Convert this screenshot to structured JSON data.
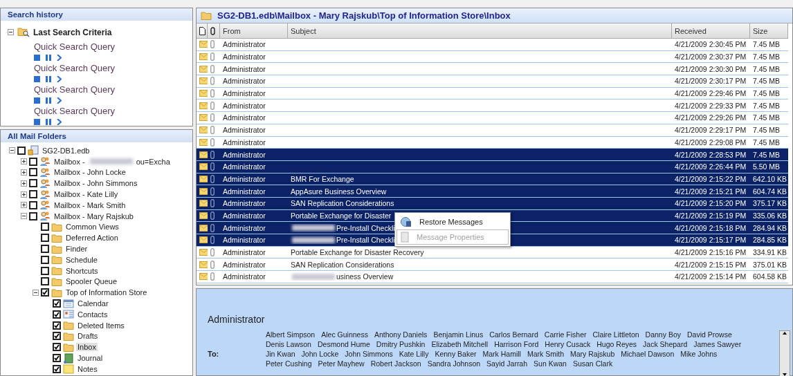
{
  "search_history": {
    "title": "Search history",
    "root": {
      "label": "Last Search Criteria",
      "expanded": true
    },
    "queries": [
      {
        "label": "Quick Search Query"
      },
      {
        "label": "Quick Search Query"
      },
      {
        "label": "Quick Search Query"
      },
      {
        "label": "Quick Search Query"
      }
    ]
  },
  "folders": {
    "title": "All Mail Folders",
    "tree": [
      {
        "label": "SG2-DB1.edb",
        "kind": "database",
        "checked": false,
        "expanded": true,
        "children": [
          {
            "label": "Mailbox -",
            "redacted": true,
            "label_end": "ou=Excha",
            "kind": "mailbox",
            "checked": false,
            "expanded": false
          },
          {
            "label": "Mailbox - John Locke",
            "kind": "mailbox",
            "checked": false,
            "expanded": false
          },
          {
            "label": "Mailbox - John Simmons",
            "kind": "mailbox",
            "checked": false,
            "expanded": false
          },
          {
            "label": "Mailbox - Kate Lilly",
            "kind": "mailbox",
            "checked": false,
            "expanded": false
          },
          {
            "label": "Mailbox - Mark Smith",
            "kind": "mailbox",
            "checked": false,
            "expanded": false
          },
          {
            "label": "Mailbox - Mary Rajskub",
            "kind": "mailbox",
            "checked": false,
            "expanded": true,
            "children": [
              {
                "label": "Common Views",
                "kind": "folder",
                "checked": false
              },
              {
                "label": "Deferred Action",
                "kind": "folder",
                "checked": false
              },
              {
                "label": "Finder",
                "kind": "folder",
                "checked": false
              },
              {
                "label": "Schedule",
                "kind": "folder",
                "checked": false
              },
              {
                "label": "Shortcuts",
                "kind": "folder",
                "checked": false
              },
              {
                "label": "Spooler Queue",
                "kind": "folder",
                "checked": false
              },
              {
                "label": "Top of Information Store",
                "kind": "folder",
                "checked": true,
                "expanded": true,
                "children": [
                  {
                    "label": "Calendar",
                    "kind": "calendar",
                    "checked": true,
                    "selected": false
                  },
                  {
                    "label": "Contacts",
                    "kind": "contacts",
                    "checked": true,
                    "selected": false
                  },
                  {
                    "label": "Deleted Items",
                    "kind": "folder",
                    "checked": true,
                    "selected": false
                  },
                  {
                    "label": "Drafts",
                    "kind": "folder",
                    "checked": true,
                    "selected": false
                  },
                  {
                    "label": "Inbox",
                    "kind": "folder",
                    "checked": true,
                    "selected": true
                  },
                  {
                    "label": "Journal",
                    "kind": "journal",
                    "checked": true,
                    "selected": false
                  },
                  {
                    "label": "Notes",
                    "kind": "notes",
                    "checked": true,
                    "selected": false
                  }
                ]
              }
            ]
          }
        ]
      }
    ]
  },
  "messages": {
    "path": "SG2-DB1.edb\\Mailbox - Mary Rajskub\\Top of Information Store\\Inbox",
    "columns": [
      "From",
      "Subject",
      "Received",
      "Size"
    ],
    "rows": [
      {
        "from": "Administrator",
        "received": "4/21/2009 2:30:45 PM",
        "size": "7.45 MB",
        "selected": false
      },
      {
        "from": "Administrator",
        "received": "4/21/2009 2:30:37 PM",
        "size": "7.45 MB",
        "selected": false
      },
      {
        "from": "Administrator",
        "received": "4/21/2009 2:30:30 PM",
        "size": "7.45 MB",
        "selected": false
      },
      {
        "from": "Administrator",
        "received": "4/21/2009 2:30:17 PM",
        "size": "7.45 MB",
        "selected": false
      },
      {
        "from": "Administrator",
        "received": "4/21/2009 2:29:46 PM",
        "size": "7.45 MB",
        "selected": false
      },
      {
        "from": "Administrator",
        "received": "4/21/2009 2:29:33 PM",
        "size": "7.45 MB",
        "selected": false
      },
      {
        "from": "Administrator",
        "received": "4/21/2009 2:29:26 PM",
        "size": "7.45 MB",
        "selected": false
      },
      {
        "from": "Administrator",
        "received": "4/21/2009 2:29:17 PM",
        "size": "7.45 MB",
        "selected": false
      },
      {
        "from": "Administrator",
        "received": "4/21/2009 2:29:08 PM",
        "size": "7.45 MB",
        "selected": false
      },
      {
        "from": "Administrator",
        "received": "4/21/2009 2:28:53 PM",
        "size": "7.45 MB",
        "selected": true
      },
      {
        "from": "Administrator",
        "received": "4/21/2009 2:26:44 PM",
        "size": "5.50 MB",
        "selected": true
      },
      {
        "from": "Administrator",
        "subject": "BMR For Exchange",
        "received": "4/21/2009 2:15:22 PM",
        "size": "642.10 KB",
        "selected": true
      },
      {
        "from": "Administrator",
        "subject": "AppAsure Business Overview",
        "received": "4/21/2009 2:15:21 PM",
        "size": "604.74 KB",
        "selected": true
      },
      {
        "from": "Administrator",
        "subject": "SAN Replication Considerations",
        "received": "4/21/2009 2:15:20 PM",
        "size": "375.17 KB",
        "selected": true
      },
      {
        "from": "Administrator",
        "subject": "Portable Exchange for Disaster",
        "received": "4/21/2009 2:15:19 PM",
        "size": "335.06 KB",
        "selected": true
      },
      {
        "from": "Administrator",
        "subject": "Pre-Install Checkli",
        "redacted": true,
        "received": "4/21/2009 2:15:18 PM",
        "size": "284.94 KB",
        "selected": true
      },
      {
        "from": "Administrator",
        "subject": "Pre-Install Checkli",
        "redacted": true,
        "received": "4/21/2009 2:15:17 PM",
        "size": "284.85 KB",
        "selected": true
      },
      {
        "from": "Administrator",
        "subject": "Portable Exchange for Disaster Recovery",
        "received": "4/21/2009 2:15:16 PM",
        "size": "334.91 KB",
        "selected": false
      },
      {
        "from": "Administrator",
        "subject": "SAN Replication Considerations",
        "received": "4/21/2009 2:15:15 PM",
        "size": "375.01 KB",
        "selected": false
      },
      {
        "from": "Administrator",
        "subject": "usiness Overview",
        "redacted": true,
        "received": "4/21/2009 2:15:14 PM",
        "size": "604.58 KB",
        "selected": false
      }
    ]
  },
  "context_menu": [
    {
      "label": "Restore Messages",
      "kind": "restore",
      "disabled": false
    },
    {
      "label": "Message Properties",
      "kind": "properties",
      "disabled": true
    }
  ],
  "preview": {
    "from": "Administrator",
    "to_label": "To:",
    "recipient_lines": [
      [
        "Albert Simpson",
        "Alec Guinness",
        "Anthony Daniels",
        "Benjamin Linus",
        "Carlos Bernard",
        "Carrie Fisher",
        "Claire Littleton",
        "Danny Boy",
        "David Prowse"
      ],
      [
        "Denis Lawson",
        "Desmond Hume",
        "Dmitry Pushkin",
        "Elizabeth Mitchell",
        "Harrison Ford",
        "Henry Cusack",
        "Hugo Reyes",
        "Jack Shepard",
        "James Sawyer"
      ],
      [
        "Jin Kwan",
        "John Locke",
        "John Simmons",
        "Kate Lilly",
        "Kenny Baker",
        "Mark Hamill",
        "Mark Smith",
        "Mary Rajskub",
        "Michael Dawson",
        "Mike Johns"
      ],
      [
        "Peter Cushing",
        "Peter Mayhew",
        "Robert Jackson",
        "Sandra Johnson",
        "Sayid Jarrah",
        "Sun Kwan",
        "Susan Clark"
      ]
    ]
  }
}
